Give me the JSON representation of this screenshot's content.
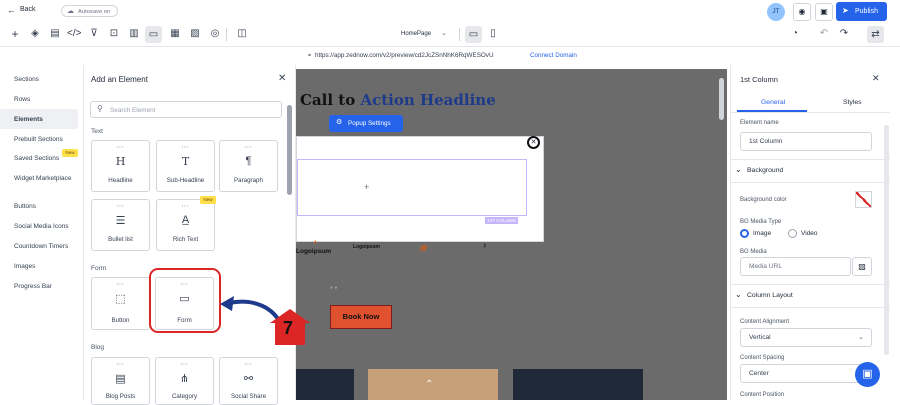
{
  "topbar": {
    "back_label": "Back",
    "autosave_label": "Autosave on",
    "avatar_initials": "JT",
    "publish_label": "Publish"
  },
  "toolbar": {
    "page_select": "HomePage"
  },
  "urlbar": {
    "url": "https://app.zednow.com/v2/preview/cd2JcZSnNhK6RqWESOvU",
    "connect_label": "Connect Domain"
  },
  "nav": {
    "items": [
      "Sections",
      "Rows",
      "Elements",
      "Prebuilt Sections",
      "Saved Sections",
      "Widget Marketplace",
      "Buttons",
      "Social Media Icons",
      "Countdown Timers",
      "Images",
      "Progress Bar"
    ],
    "new_badge": "New",
    "active_index": 2
  },
  "panel": {
    "title": "Add an Element",
    "search_placeholder": "Search Element",
    "sections": [
      "Text",
      "Form",
      "Blog"
    ],
    "text_elements": [
      "Headline",
      "Sub-Headline",
      "Paragraph",
      "Bullet list",
      "Rich Text"
    ],
    "new_badge": "New",
    "form_elements": [
      "Button",
      "Form"
    ],
    "blog_elements": [
      "Blog Posts",
      "Category",
      "Social Share"
    ]
  },
  "canvas": {
    "headline_part1": "Call to ",
    "headline_part2": "Action Headline",
    "popup_settings_label": "Popup Settings",
    "column_tag": "1ST COLUMN",
    "logo1": "Logoipsum",
    "logo2": "Logoipsum",
    "book_label": "Book Now"
  },
  "step_badge": "7",
  "rightp": {
    "title": "1st Column",
    "tabs": [
      "General",
      "Styles"
    ],
    "element_name_label": "Element name",
    "element_name_value": "1st Column",
    "background_title": "Background",
    "bg_color_label": "Background color",
    "bg_media_type_label": "BG Media Type",
    "media_options": [
      "Image",
      "Video"
    ],
    "bg_media_label": "BG Media",
    "media_url_placeholder": "Media URL",
    "column_layout_title": "Column Layout",
    "content_alignment_label": "Content Alignment",
    "content_alignment_value": "Vertical",
    "content_spacing_label": "Content Spacing",
    "content_spacing_value": "Center",
    "content_position_label": "Content Position"
  },
  "colors": {
    "accent": "#2563eb",
    "highlight": "#dc2626",
    "arrow": "#1e3a8a",
    "book_btn": "#e0512f",
    "headline_blue": "#1e3a8a"
  }
}
